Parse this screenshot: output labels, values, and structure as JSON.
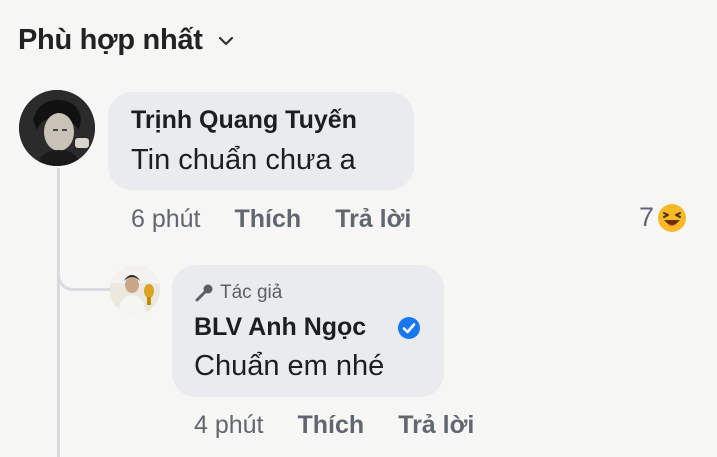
{
  "sort": {
    "label": "Phù hợp nhất"
  },
  "comments": [
    {
      "author": "Trịnh Quang Tuyến",
      "text": "Tin chuẩn chưa a",
      "time": "6 phút",
      "like_label": "Thích",
      "reply_label": "Trả lời",
      "reaction_count": "7",
      "reaction_icon": "laughing-emoji-icon"
    }
  ],
  "replies": [
    {
      "badge": "Tác giả",
      "author": "BLV Anh Ngọc",
      "verified": true,
      "text": "Chuẩn em nhé",
      "time": "4 phút",
      "like_label": "Thích",
      "reply_label": "Trả lời"
    }
  ],
  "colors": {
    "verified": "#1877f2",
    "emoji": "#f7b928",
    "bubble": "#e9ebee"
  }
}
